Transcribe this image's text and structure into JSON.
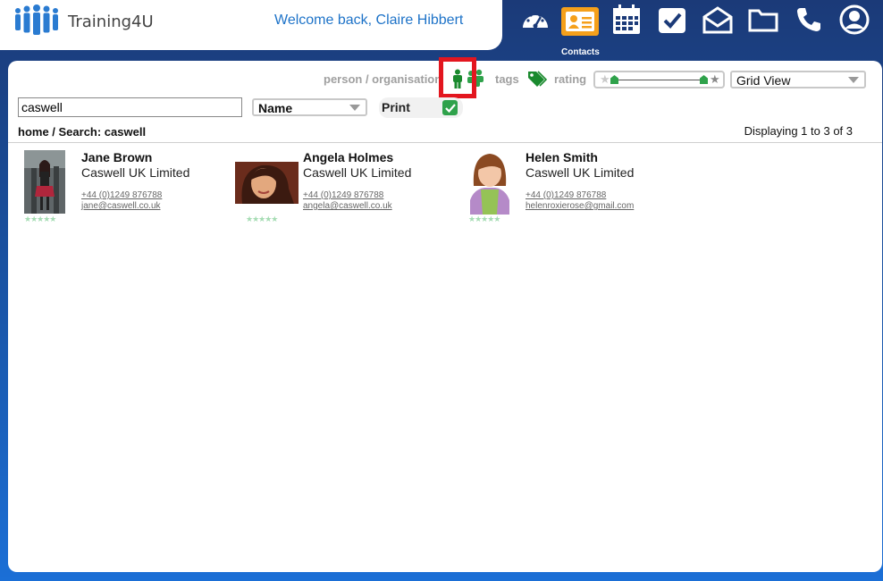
{
  "app": {
    "name": "Training4U"
  },
  "header": {
    "welcome": "Welcome back, Claire Hibbert",
    "active_label": "Contacts"
  },
  "nav": [
    {
      "icon": "dashboard-icon"
    },
    {
      "icon": "contacts-icon"
    },
    {
      "icon": "calendar-icon"
    },
    {
      "icon": "tasks-icon"
    },
    {
      "icon": "mail-icon"
    },
    {
      "icon": "folder-icon"
    },
    {
      "icon": "phone-icon"
    },
    {
      "icon": "account-icon"
    }
  ],
  "filters": {
    "person_org_label": "person / organisation",
    "tags_label": "tags",
    "rating_label": "rating",
    "view_select": "Grid View",
    "sort_select": "Name",
    "print_label": "Print"
  },
  "search": {
    "value": "caswell"
  },
  "breadcrumb": "home / Search: caswell",
  "displaying": "Displaying 1 to 3 of 3",
  "contacts": [
    {
      "name": "Jane Brown",
      "org": "Caswell UK Limited",
      "phone": "+44 (0)1249 876788",
      "email": "jane@caswell.co.uk"
    },
    {
      "name": "Angela Holmes",
      "org": "Caswell UK Limited",
      "phone": "+44 (0)1249 876788",
      "email": "angela@caswell.co.uk"
    },
    {
      "name": "Helen Smith",
      "org": "Caswell UK Limited",
      "phone": "+44 (0)1249 876788",
      "email": "helenroxierose@gmail.com"
    }
  ],
  "colors": {
    "accent": "#f5a01b",
    "brand_blue": "#1b3a78",
    "link": "#1e73c8",
    "green": "#2fa24b",
    "highlight": "#e3161f"
  }
}
